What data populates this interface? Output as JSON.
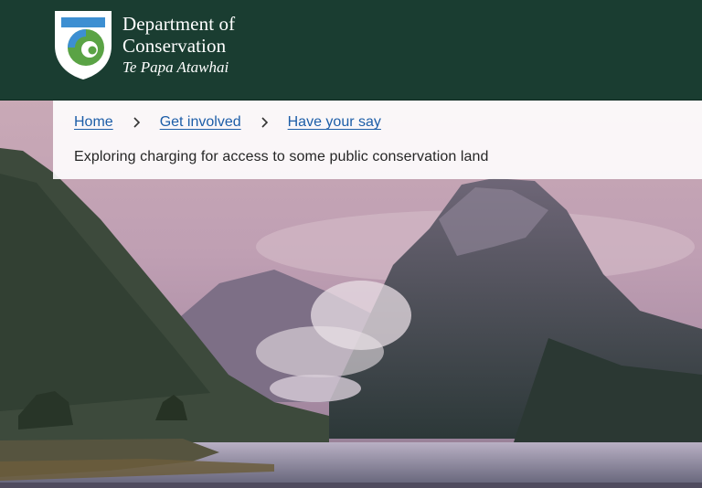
{
  "header": {
    "logo": {
      "line1": "Department of",
      "line2": "Conservation",
      "line3": "Te Papa Atawhai",
      "icon": "doc-shield-koru-icon"
    },
    "colors": {
      "background": "#1a3d31",
      "shield_blue": "#3d8fd2",
      "shield_green": "#5aa345"
    }
  },
  "breadcrumb": {
    "items": [
      {
        "label": "Home"
      },
      {
        "label": "Get involved"
      },
      {
        "label": "Have your say"
      }
    ],
    "current": "Exploring charging for access to some public conservation land",
    "link_color": "#1d5ea8"
  },
  "hero": {
    "image": "fiord-mountain-landscape"
  }
}
